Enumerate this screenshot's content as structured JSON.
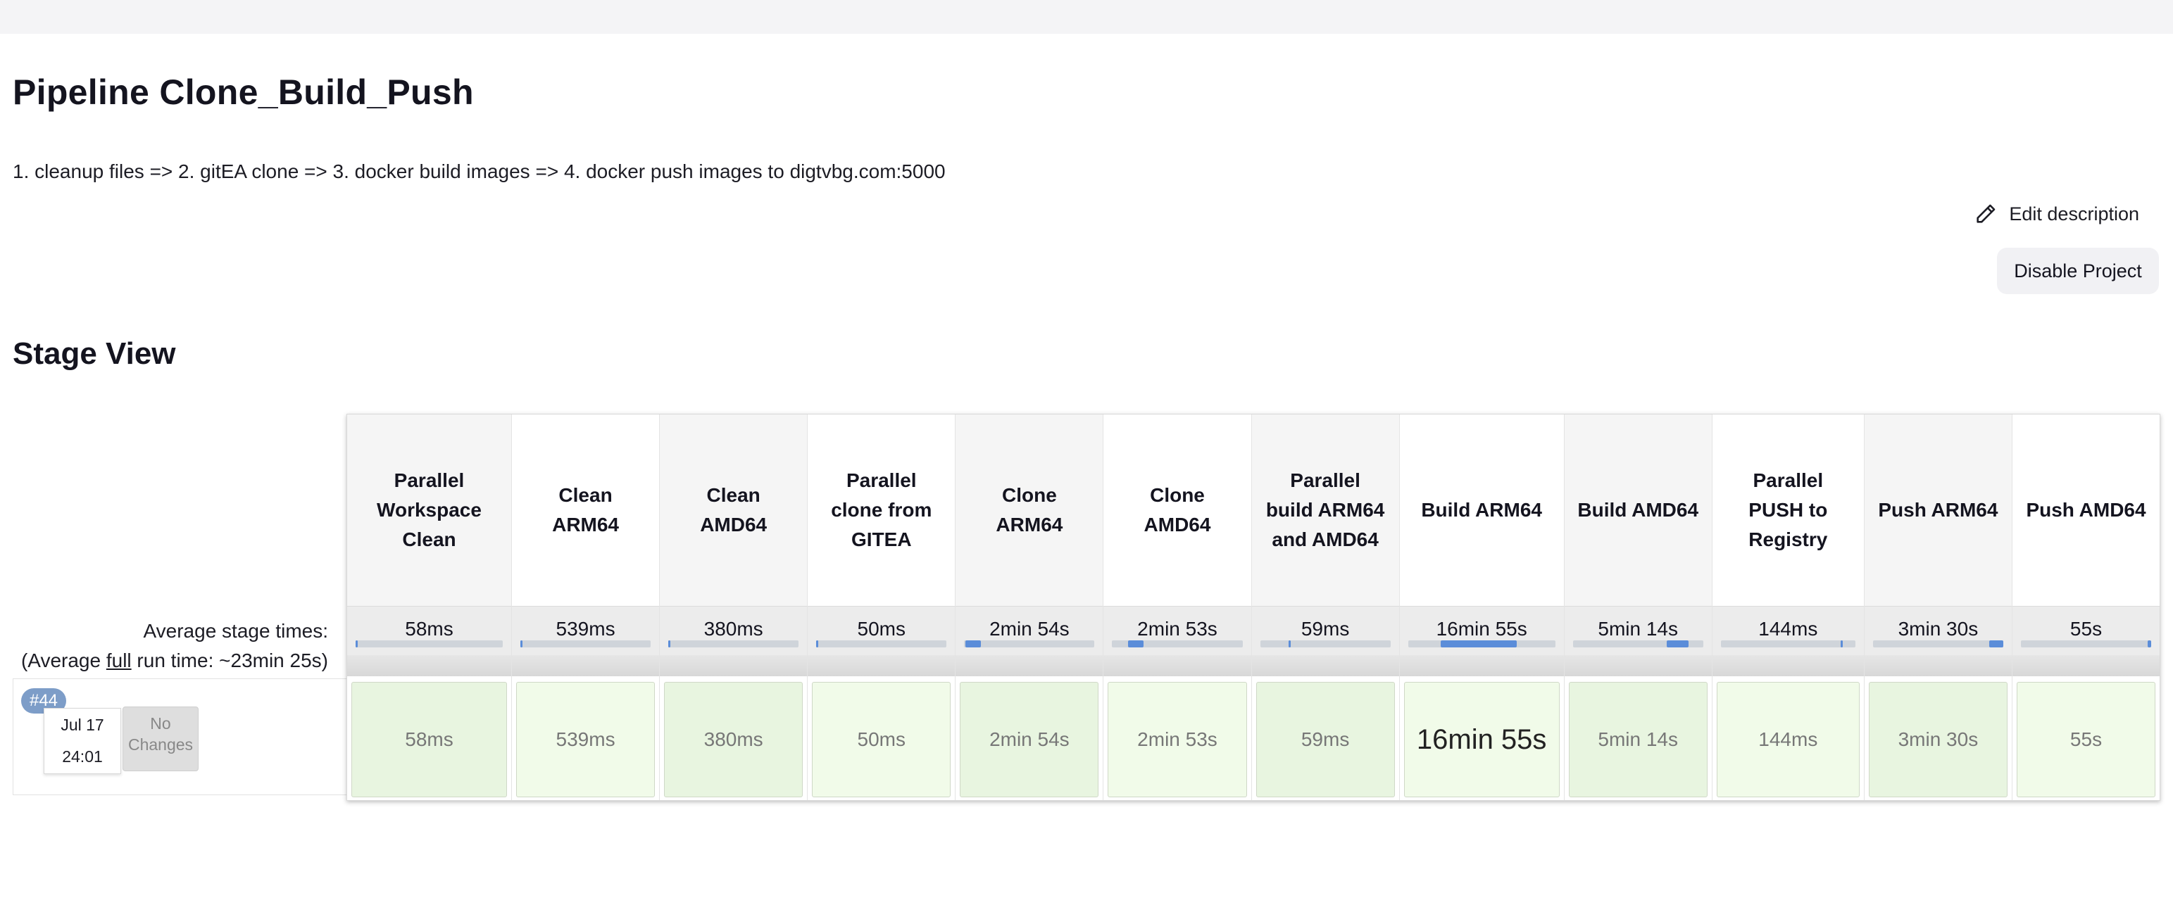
{
  "page": {
    "title": "Pipeline Clone_Build_Push",
    "description": "1. cleanup files => 2. gitEA clone => 3. docker build images => 4. docker push images to digtvbg.com:5000",
    "edit_description": "Edit description",
    "disable_project": "Disable Project",
    "stage_view_title": "Stage View"
  },
  "avg": {
    "label": "Average stage times:",
    "run_prefix": "(Average ",
    "run_full": "full",
    "run_suffix": " run time: ~23min 25s)"
  },
  "run": {
    "badge": "#44",
    "date": "Jul 17",
    "time": "24:01",
    "changes": "No Changes"
  },
  "stages": [
    {
      "name": "Parallel Workspace Clean",
      "avg": "58ms",
      "duration": "58ms",
      "bar_start": 0.0,
      "bar_width": 0.005
    },
    {
      "name": "Clean ARM64",
      "avg": "539ms",
      "duration": "539ms",
      "bar_start": 0.0,
      "bar_width": 0.01
    },
    {
      "name": "Clean AMD64",
      "avg": "380ms",
      "duration": "380ms",
      "bar_start": 0.0,
      "bar_width": 0.01
    },
    {
      "name": "Parallel clone from GITEA",
      "avg": "50ms",
      "duration": "50ms",
      "bar_start": 0.0,
      "bar_width": 0.005
    },
    {
      "name": "Clone ARM64",
      "avg": "2min 54s",
      "duration": "2min 54s",
      "bar_start": 0.01,
      "bar_width": 0.12
    },
    {
      "name": "Clone AMD64",
      "avg": "2min 53s",
      "duration": "2min 53s",
      "bar_start": 0.12,
      "bar_width": 0.12
    },
    {
      "name": "Parallel build ARM64 and AMD64",
      "avg": "59ms",
      "duration": "59ms",
      "bar_start": 0.22,
      "bar_width": 0.01
    },
    {
      "name": "Build ARM64",
      "avg": "16min 55s",
      "duration": "16min 55s",
      "bar_start": 0.22,
      "bar_width": 0.52
    },
    {
      "name": "Build AMD64",
      "avg": "5min 14s",
      "duration": "5min 14s",
      "bar_start": 0.72,
      "bar_width": 0.17
    },
    {
      "name": "Parallel PUSH to Registry",
      "avg": "144ms",
      "duration": "144ms",
      "bar_start": 0.89,
      "bar_width": 0.01
    },
    {
      "name": "Push ARM64",
      "avg": "3min 30s",
      "duration": "3min 30s",
      "bar_start": 0.89,
      "bar_width": 0.11
    },
    {
      "name": "Push AMD64",
      "avg": "55s",
      "duration": "55s",
      "bar_start": 0.97,
      "bar_width": 0.03
    }
  ],
  "colors": {
    "accent": "#5b8dd9",
    "success_cell": "#e8f5e0",
    "badge": "#7d9dc8"
  }
}
